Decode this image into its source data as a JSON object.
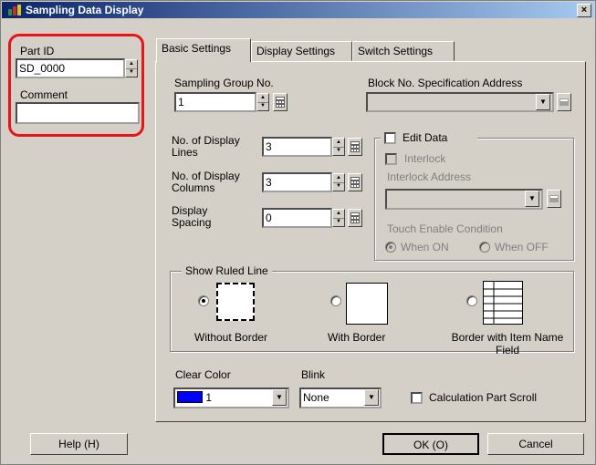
{
  "window": {
    "title": "Sampling Data Display",
    "close_label": "×"
  },
  "left": {
    "part_id_label": "Part ID",
    "part_id_value": "SD_0000",
    "comment_label": "Comment",
    "comment_value": "",
    "highlight_color": "#e8141a"
  },
  "tabs": [
    {
      "label": "Basic Settings",
      "active": true
    },
    {
      "label": "Display Settings",
      "active": false
    },
    {
      "label": "Switch Settings",
      "active": false
    }
  ],
  "basic": {
    "sampling_group_label": "Sampling Group No.",
    "sampling_group_value": "1",
    "block_no_label": "Block No. Specification Address",
    "block_no_value": "",
    "display_lines_label": "No. of Display Lines",
    "display_lines_value": "3",
    "display_columns_label": "No. of Display Columns",
    "display_columns_value": "3",
    "display_spacing_label": "Display Spacing",
    "display_spacing_value": "0",
    "edit_data_label": "Edit Data",
    "interlock_label": "Interlock",
    "interlock_address_label": "Interlock Address",
    "interlock_address_value": "",
    "touch_enable_label": "Touch Enable Condition",
    "when_on_label": "When ON",
    "when_off_label": "When OFF",
    "ruled_line": {
      "label": "Show Ruled Line",
      "options": [
        {
          "label": "Without Border",
          "selected": true
        },
        {
          "label": "With Border",
          "selected": false
        },
        {
          "label": "Border with Item Name Field",
          "selected": false
        }
      ]
    },
    "clear_color_label": "Clear Color",
    "clear_color_value": "1",
    "clear_color_swatch": "#0000ff",
    "blink_label": "Blink",
    "blink_value": "None",
    "calc_scroll_label": "Calculation Part Scroll"
  },
  "buttons": {
    "help": "Help (H)",
    "ok": "OK (O)",
    "cancel": "Cancel"
  }
}
